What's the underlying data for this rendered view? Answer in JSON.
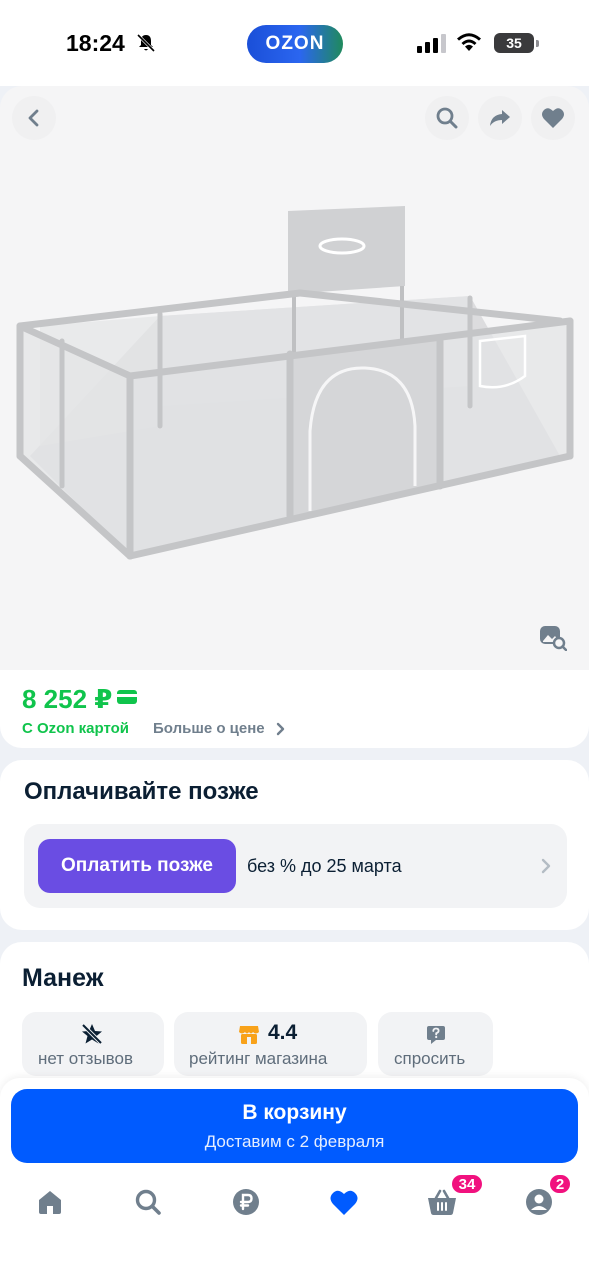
{
  "status_bar": {
    "time": "18:24",
    "logo_text": "OZON",
    "battery": "35"
  },
  "product_image": {
    "alt": "Манеж"
  },
  "price": {
    "value": "8 252 ₽",
    "with_card_label": "С Ozon картой",
    "more_about_price": "Больше о цене",
    "accent_color": "#10c44c"
  },
  "pay_later": {
    "title": "Оплачивайте позже",
    "button_label": "Оплатить позже",
    "description": "без % до 25 марта",
    "button_color": "#6a4de3"
  },
  "product": {
    "title": "Манеж",
    "chips": [
      {
        "icon": "star-slash-icon",
        "label": "нет отзывов"
      },
      {
        "icon": "store-icon",
        "value": "4.4",
        "label": "рейтинг магазина"
      },
      {
        "icon": "question-icon",
        "label": "спросить"
      }
    ]
  },
  "cta": {
    "label": "В корзину",
    "sub_label": "Доставим с 2 февраля",
    "color": "#005bff"
  },
  "tab_bar": {
    "items": [
      {
        "icon": "home-icon"
      },
      {
        "icon": "search-icon"
      },
      {
        "icon": "ruble-icon"
      },
      {
        "icon": "heart-icon",
        "active": true
      },
      {
        "icon": "basket-icon",
        "badge": "34"
      },
      {
        "icon": "profile-icon",
        "badge": "2"
      }
    ]
  }
}
